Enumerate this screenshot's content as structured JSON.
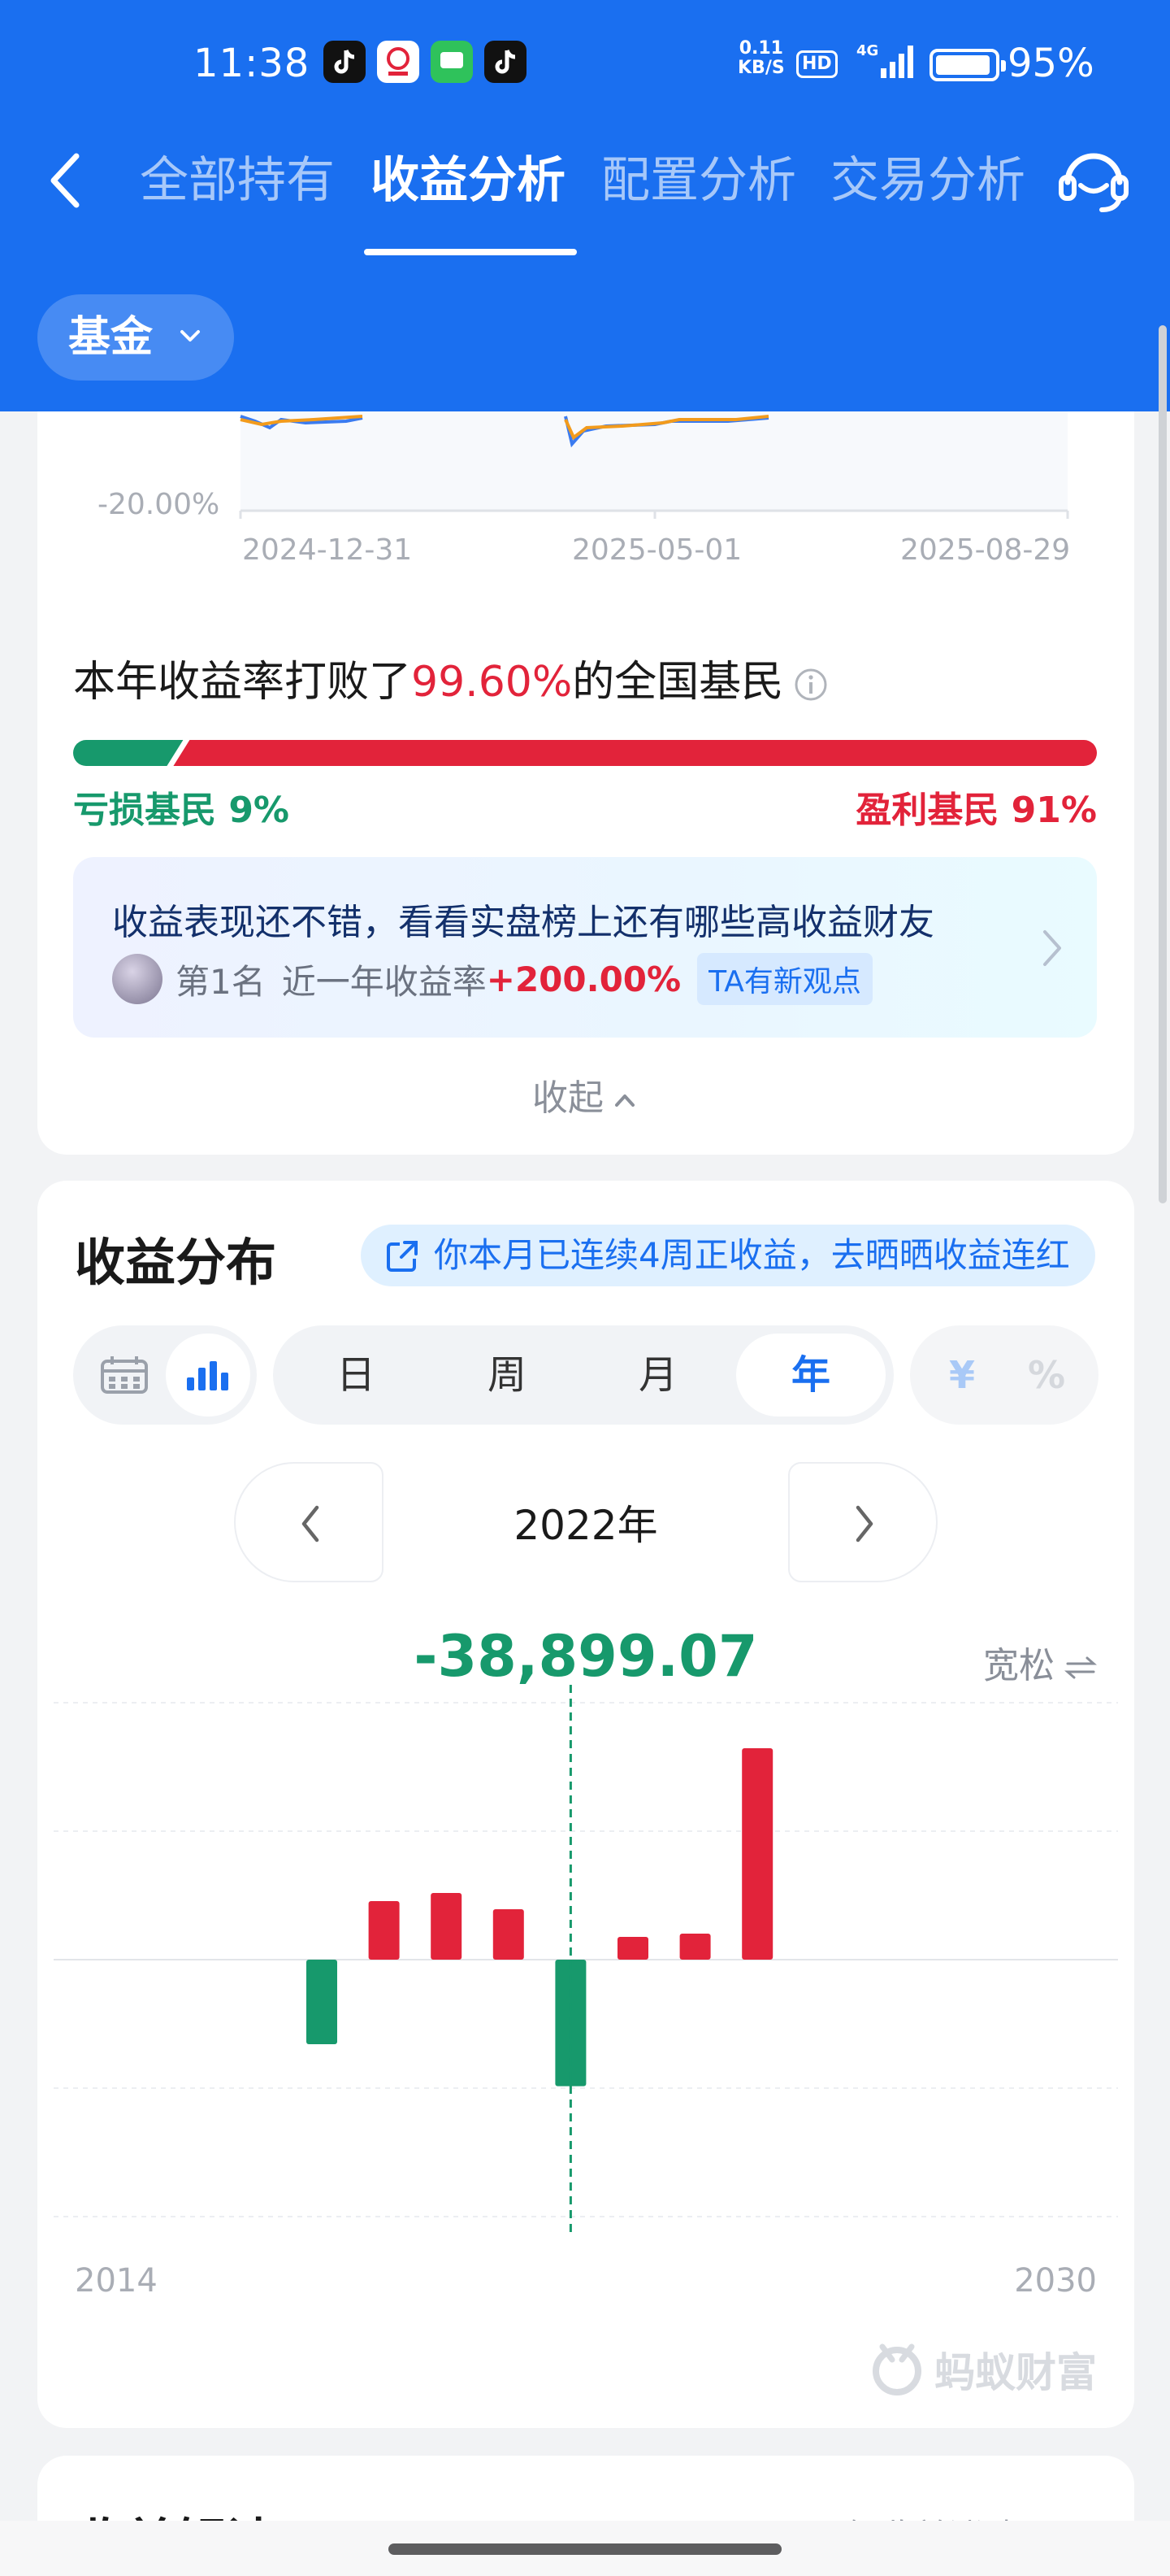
{
  "status": {
    "time": "11:38",
    "net_rate_value": "0.11",
    "net_rate_unit": "KB/S",
    "hd": "HD",
    "network": "4G",
    "battery": "95%"
  },
  "tabs": [
    {
      "label": "全部持有",
      "active": false
    },
    {
      "label": "收益分析",
      "active": true
    },
    {
      "label": "配置分析",
      "active": false
    },
    {
      "label": "交易分析",
      "active": false
    }
  ],
  "filter_chip": "基金",
  "trend": {
    "y_label": "-20.00%",
    "x_labels": [
      "2024-12-31",
      "2025-05-01",
      "2025-08-29"
    ]
  },
  "ranking": {
    "prefix": "本年收益率打败了",
    "percent": "99.60%",
    "suffix": "的全国基民",
    "lose_label": "亏损基民 9%",
    "win_label": "盈利基民 91%",
    "lose_fraction": 0.09
  },
  "promo": {
    "title": "收益表现还不错，看看实盘榜上还有哪些高收益财友",
    "rank": "第1名",
    "metric": "近一年收益率",
    "value": "+200.00%",
    "badge": "TA有新观点"
  },
  "collapse_label": "收起",
  "distribution": {
    "title": "收益分布",
    "share_text": "你本月已连续4周正收益，去晒晒收益连红",
    "periods": [
      "日",
      "周",
      "月",
      "年"
    ],
    "active_period": "年",
    "unit_currency": "¥",
    "unit_percent": "%",
    "year_label": "2022年",
    "selected_value": "-38,899.07",
    "density_label": "宽松",
    "x_start": "2014",
    "x_end": "2030",
    "watermark": "蚂蚁财富"
  },
  "chart_data": {
    "type": "bar",
    "categories": [
      "2018",
      "2019",
      "2020",
      "2021",
      "2022",
      "2023",
      "2024",
      "2025"
    ],
    "values": [
      -26000,
      18000,
      20500,
      15500,
      -38899.07,
      7000,
      8000,
      65000
    ],
    "selected": "2022",
    "colors": {
      "positive": "#e2233a",
      "negative": "#17996c"
    }
  },
  "interpretation": {
    "title": "收益解读",
    "right_text": "了解收益涨跌原因"
  }
}
